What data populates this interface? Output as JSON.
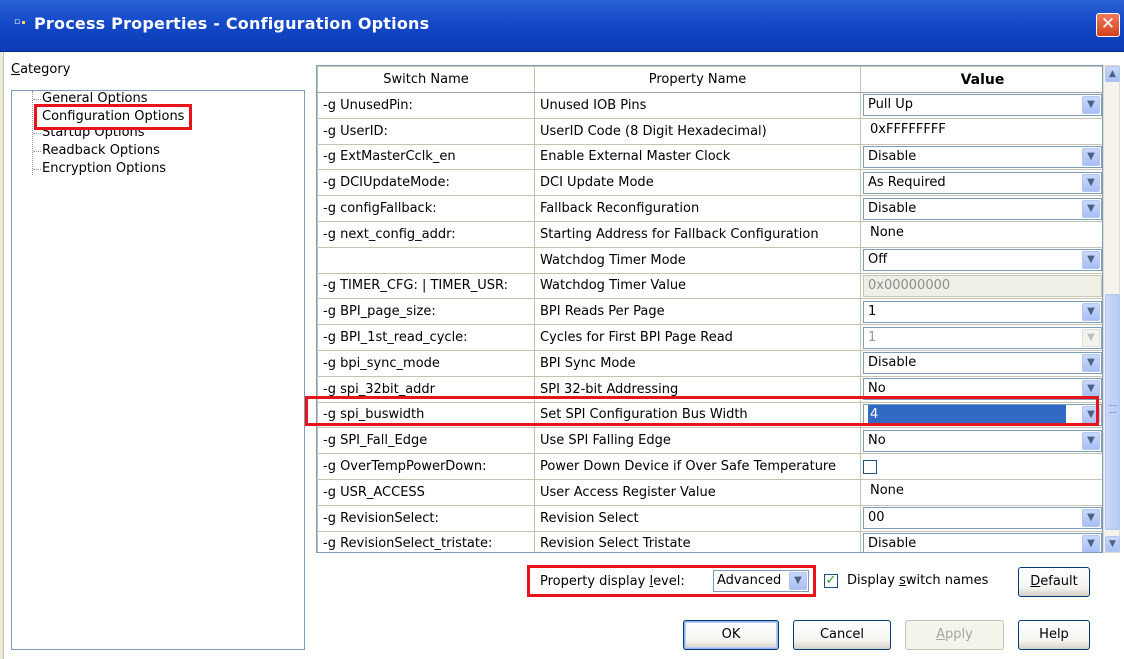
{
  "window": {
    "title": "Process Properties - Configuration Options",
    "close_glyph": "✕"
  },
  "category": {
    "label_prefix": "C",
    "label_rest": "ategory",
    "items": [
      {
        "label": "General Options"
      },
      {
        "label": "Configuration Options",
        "selected": true
      },
      {
        "label": "Startup Options"
      },
      {
        "label": "Readback Options"
      },
      {
        "label": "Encryption Options"
      }
    ]
  },
  "grid": {
    "columns": [
      "Switch Name",
      "Property Name",
      "Value"
    ],
    "rows": [
      {
        "switch": "-g UnusedPin:",
        "property": "Unused IOB Pins",
        "value": "Pull Up",
        "kind": "combo"
      },
      {
        "switch": "-g UserID:",
        "property": "UserID Code (8 Digit Hexadecimal)",
        "value": "0xFFFFFFFF",
        "kind": "text"
      },
      {
        "switch": "-g ExtMasterCclk_en",
        "property": "Enable External Master Clock",
        "value": "Disable",
        "kind": "combo"
      },
      {
        "switch": "-g DCIUpdateMode:",
        "property": "DCI Update Mode",
        "value": "As Required",
        "kind": "combo"
      },
      {
        "switch": "-g configFallback:",
        "property": "Fallback Reconfiguration",
        "value": "Disable",
        "kind": "combo"
      },
      {
        "switch": "-g next_config_addr:",
        "property": "Starting Address for Fallback Configuration",
        "value": "None",
        "kind": "text"
      },
      {
        "switch": "",
        "property": "Watchdog Timer Mode",
        "value": "Off",
        "kind": "combo"
      },
      {
        "switch": "-g TIMER_CFG: | TIMER_USR:",
        "property": "Watchdog Timer Value",
        "value": "0x00000000",
        "kind": "disabled"
      },
      {
        "switch": "-g BPI_page_size:",
        "property": "BPI Reads Per Page",
        "value": "1",
        "kind": "combo"
      },
      {
        "switch": "-g BPI_1st_read_cycle:",
        "property": "Cycles for First BPI Page Read",
        "value": "1",
        "kind": "combo-disabled"
      },
      {
        "switch": "-g bpi_sync_mode",
        "property": "BPI Sync Mode",
        "value": "Disable",
        "kind": "combo"
      },
      {
        "switch": "-g spi_32bit_addr",
        "property": "SPI 32-bit Addressing",
        "value": "No",
        "kind": "combo"
      },
      {
        "switch": "-g spi_buswidth",
        "property": "Set SPI Configuration Bus Width",
        "value": "4",
        "kind": "combo-selected"
      },
      {
        "switch": "-g SPI_Fall_Edge",
        "property": "Use SPI Falling Edge",
        "value": "No",
        "kind": "combo"
      },
      {
        "switch": "-g OverTempPowerDown:",
        "property": "Power Down Device if Over Safe Temperature",
        "value": "",
        "kind": "checkbox"
      },
      {
        "switch": "-g USR_ACCESS",
        "property": "User Access Register Value",
        "value": "None",
        "kind": "text"
      },
      {
        "switch": "-g RevisionSelect:",
        "property": "Revision Select",
        "value": "00",
        "kind": "combo"
      },
      {
        "switch": "-g RevisionSelect_tristate:",
        "property": "Revision Select Tristate",
        "value": "Disable",
        "kind": "combo"
      }
    ]
  },
  "footer": {
    "display_level_label_pre": "Property display ",
    "display_level_label_u": "l",
    "display_level_label_post": "evel:",
    "display_level_value": "Advanced",
    "display_switch_names_pre": "Display ",
    "display_switch_names_u": "s",
    "display_switch_names_post": "witch names",
    "display_switch_names_checked": true,
    "default_label_u": "D",
    "default_label_rest": "efault"
  },
  "buttons": {
    "ok": "OK",
    "cancel": "Cancel",
    "apply_u": "A",
    "apply_rest": "pply",
    "help": "Help"
  },
  "colors": {
    "titlebar": "#1448c8",
    "highlight": "#e8141c",
    "selection": "#316ac5"
  }
}
